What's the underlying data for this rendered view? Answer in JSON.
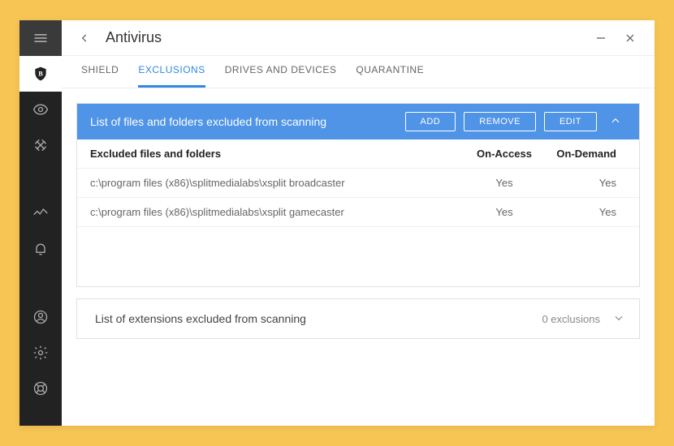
{
  "title": "Antivirus",
  "tabs": [
    "SHIELD",
    "EXCLUSIONS",
    "DRIVES AND DEVICES",
    "QUARANTINE"
  ],
  "activeTab": 1,
  "panel": {
    "title": "List of files and folders excluded from scanning",
    "buttons": {
      "add": "ADD",
      "remove": "REMOVE",
      "edit": "EDIT"
    },
    "columns": {
      "path": "Excluded files and folders",
      "access": "On-Access",
      "demand": "On-Demand"
    },
    "rows": [
      {
        "path": "c:\\program files (x86)\\splitmedialabs\\xsplit broadcaster",
        "access": "Yes",
        "demand": "Yes"
      },
      {
        "path": "c:\\program files (x86)\\splitmedialabs\\xsplit gamecaster",
        "access": "Yes",
        "demand": "Yes"
      }
    ]
  },
  "extPanel": {
    "title": "List of extensions excluded from scanning",
    "count": "0 exclusions"
  }
}
